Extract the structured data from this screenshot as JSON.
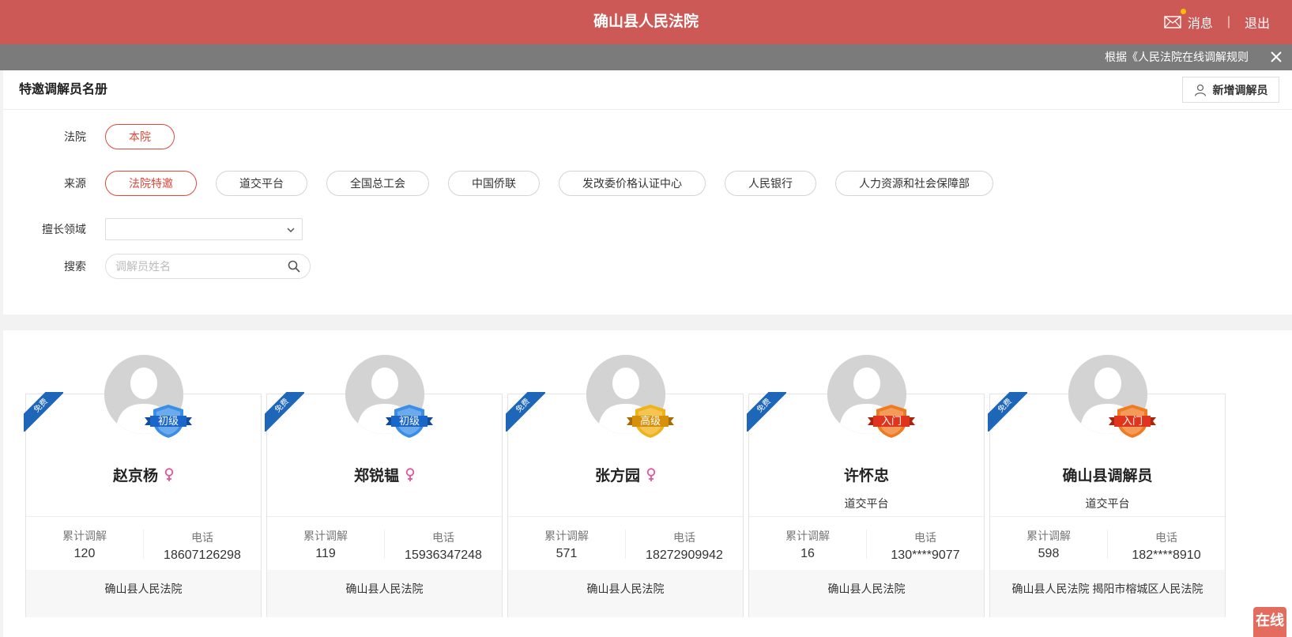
{
  "header": {
    "title": "确山县人民法院",
    "messages_label": "消息",
    "separator": "|",
    "logout_label": "退出",
    "bg_color": "#cd5956"
  },
  "notice": {
    "text": "根据《人民法院在线调解规则"
  },
  "roster": {
    "title": "特邀调解员名册",
    "add_label": "新增调解员"
  },
  "filters": {
    "court_label": "法院",
    "court_options": [
      "本院"
    ],
    "source_label": "来源",
    "source_options": [
      "法院特邀",
      "道交平台",
      "全国总工会",
      "中国侨联",
      "发改委价格认证中心",
      "人民银行",
      "人力资源和社会保障部"
    ],
    "area_label": "擅长领域",
    "area_value": "",
    "search_label": "搜索",
    "search_placeholder": "调解员姓名",
    "accent_color": "#e0473b"
  },
  "card_labels": {
    "ribbon": "免费",
    "count_label": "累计调解",
    "phone_label": "电话"
  },
  "mediators": [
    {
      "name": "赵京杨",
      "female": true,
      "source": "",
      "level": "初级",
      "level_color": "blue",
      "count": "120",
      "phone": "18607126298",
      "court": "确山县人民法院"
    },
    {
      "name": "郑锐韫",
      "female": true,
      "source": "",
      "level": "初级",
      "level_color": "blue",
      "count": "119",
      "phone": "15936347248",
      "court": "确山县人民法院"
    },
    {
      "name": "张方园",
      "female": true,
      "source": "",
      "level": "高级",
      "level_color": "gold",
      "count": "571",
      "phone": "18272909942",
      "court": "确山县人民法院"
    },
    {
      "name": "许怀忠",
      "female": false,
      "source": "道交平台",
      "level": "入门",
      "level_color": "orange",
      "count": "16",
      "phone": "130****9077",
      "court": "确山县人民法院"
    },
    {
      "name": "确山县调解员",
      "female": false,
      "source": "道交平台",
      "level": "入门",
      "level_color": "orange",
      "count": "598",
      "phone": "182****8910",
      "court": "确山县人民法院   揭阳市榕城区人民法院"
    }
  ],
  "online_label": "在线"
}
